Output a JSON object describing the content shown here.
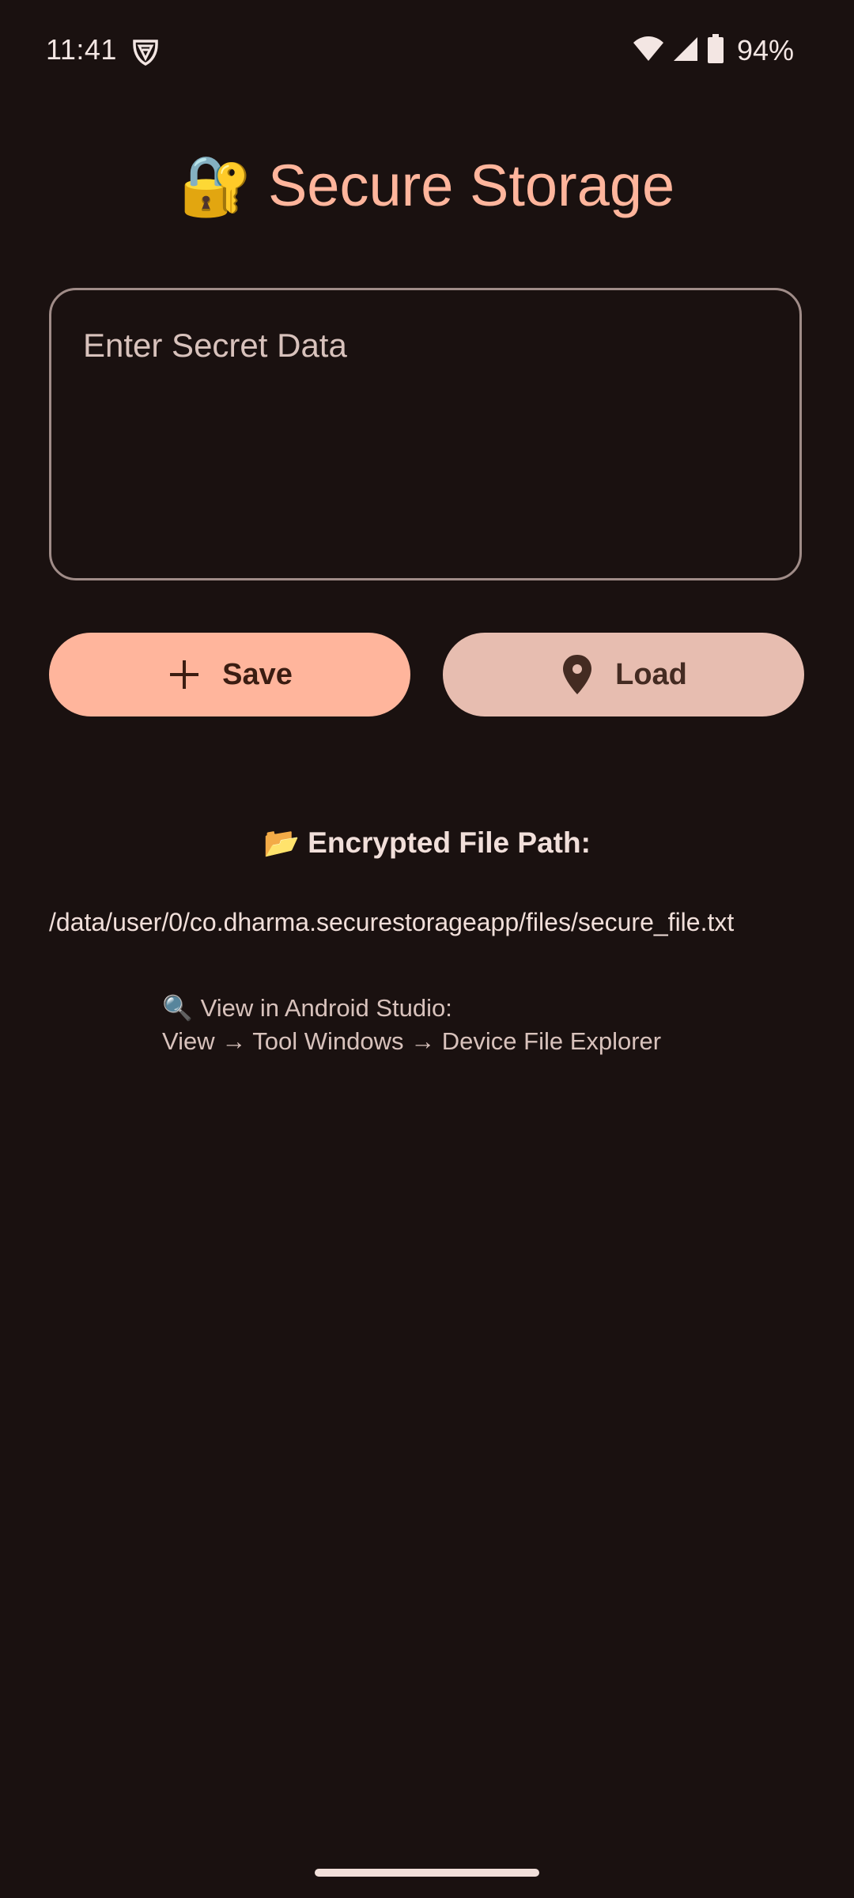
{
  "status_bar": {
    "time": "11:41",
    "battery_percent": "94%",
    "icons": [
      "vpn-shield-icon",
      "wifi-icon",
      "cellular-signal-icon",
      "battery-icon"
    ]
  },
  "header": {
    "emoji": "🔐",
    "title": "Secure Storage"
  },
  "secret_input": {
    "placeholder": "Enter Secret Data",
    "value": ""
  },
  "actions": {
    "save_label": "Save",
    "save_icon": "plus-icon",
    "load_label": "Load",
    "load_icon": "location-pin-icon"
  },
  "file_info": {
    "heading_emoji": "📂",
    "heading": "Encrypted File Path:",
    "path": "/data/user/0/co.dharma.securestorageapp/files/secure_file.txt"
  },
  "hint": {
    "emoji": "🔍",
    "line1": "View in Android Studio:",
    "line2": "View → Tool Windows → Device File Explorer"
  },
  "colors": {
    "background": "#1a1110",
    "accent": "#ffb59c",
    "secondary_button": "#e7bdb0",
    "outline": "#a08c88"
  }
}
